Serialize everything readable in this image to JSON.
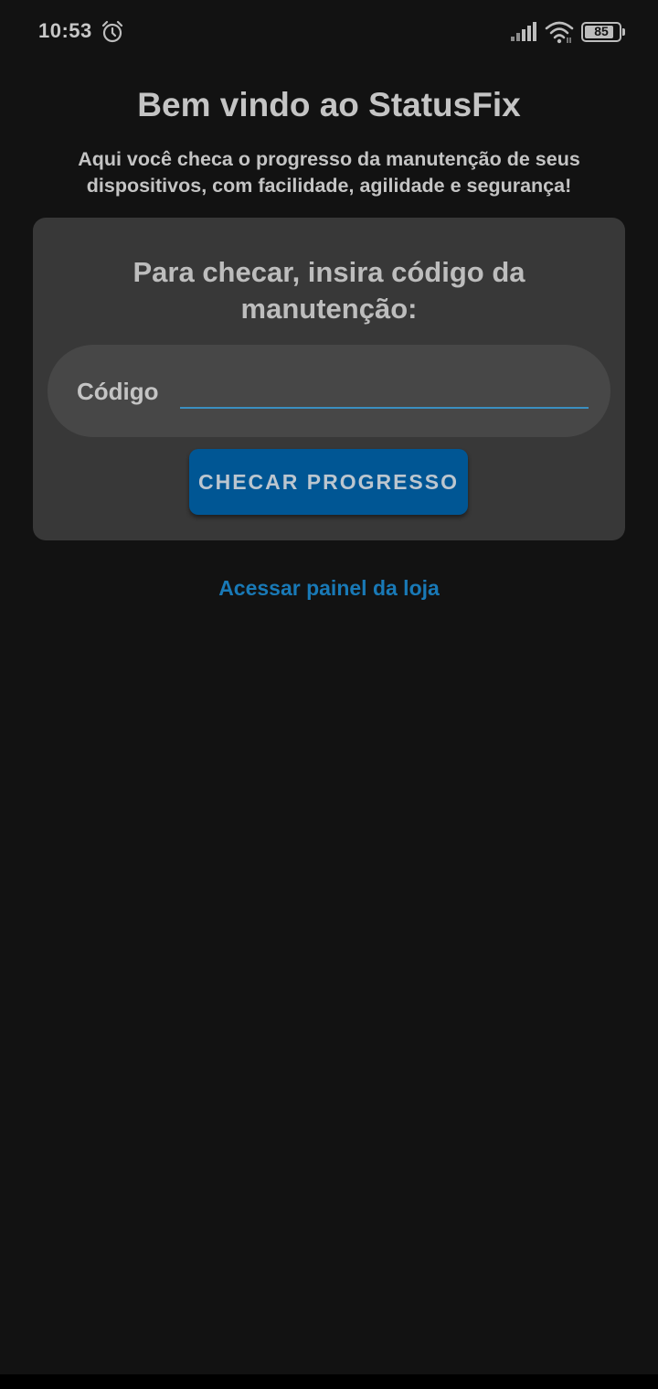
{
  "status_bar": {
    "time": "10:53",
    "battery_level": "85",
    "battery_fraction": 0.85,
    "icons": [
      "alarm-clock-icon",
      "signal-icon",
      "wifi-icon",
      "battery-icon"
    ]
  },
  "header": {
    "title": "Bem vindo ao StatusFix",
    "subtitle": "Aqui você checa o progresso da manutenção de seus dispositivos, com facilidade, agilidade e segurança!"
  },
  "card": {
    "heading": "Para checar, insira código da manutenção:",
    "code_label": "Código",
    "code_value": "",
    "button_label": "CHECAR PROGRESSO"
  },
  "footer": {
    "store_link_label": "Acessar painel da loja"
  },
  "colors": {
    "background": "#121212",
    "card": "#383838",
    "field": "#474747",
    "accent": "#005694",
    "link": "#1979b6",
    "input_underline": "#3b8fc0"
  }
}
